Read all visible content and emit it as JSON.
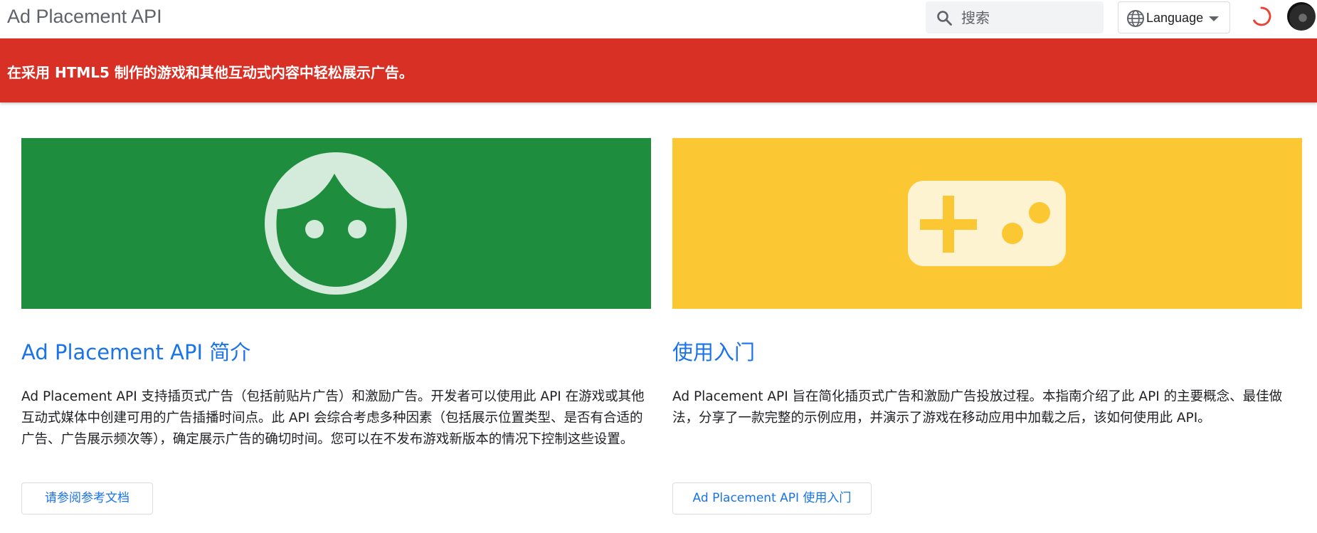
{
  "header": {
    "site_title": "Ad Placement API",
    "search": {
      "placeholder": "搜索",
      "icon": "search-icon"
    },
    "language_button": {
      "label": "Language",
      "icon": "globe-icon"
    },
    "loading_indicator": "spinner-icon",
    "avatar": "avatar"
  },
  "banner": {
    "text": "在采用 HTML5 制作的游戏和其他互动式内容中轻松展示广告。",
    "color": "#d93025"
  },
  "cards": [
    {
      "hero_color": "#1e8e3e",
      "hero_icon": "face-icon",
      "title": "Ad Placement API 简介",
      "description": "Ad Placement API 支持插页式广告（包括前贴片广告）和激励广告。开发者可以使用此 API 在游戏或其他互动式媒体中创建可用的广告插播时间点。此 API 会综合考虑多种因素（包括展示位置类型、是否有合适的广告、广告展示频次等），确定展示广告的确切时间。您可以在不发布游戏新版本的情况下控制这些设置。",
      "button_label": "请参阅参考文档"
    },
    {
      "hero_color": "#fbc834",
      "hero_icon": "gamepad-icon",
      "title": "使用入门",
      "description": "Ad Placement API 旨在简化插页式广告和激励广告投放过程。本指南介绍了此 API 的主要概念、最佳做法，分享了一款完整的示例应用，并演示了游戏在移动应用中加载之后，该如何使用此 API。",
      "button_label": "Ad Placement API 使用入门"
    }
  ],
  "colors": {
    "link_blue": "#1a73e8",
    "text": "#202124",
    "muted": "#5f6368"
  }
}
